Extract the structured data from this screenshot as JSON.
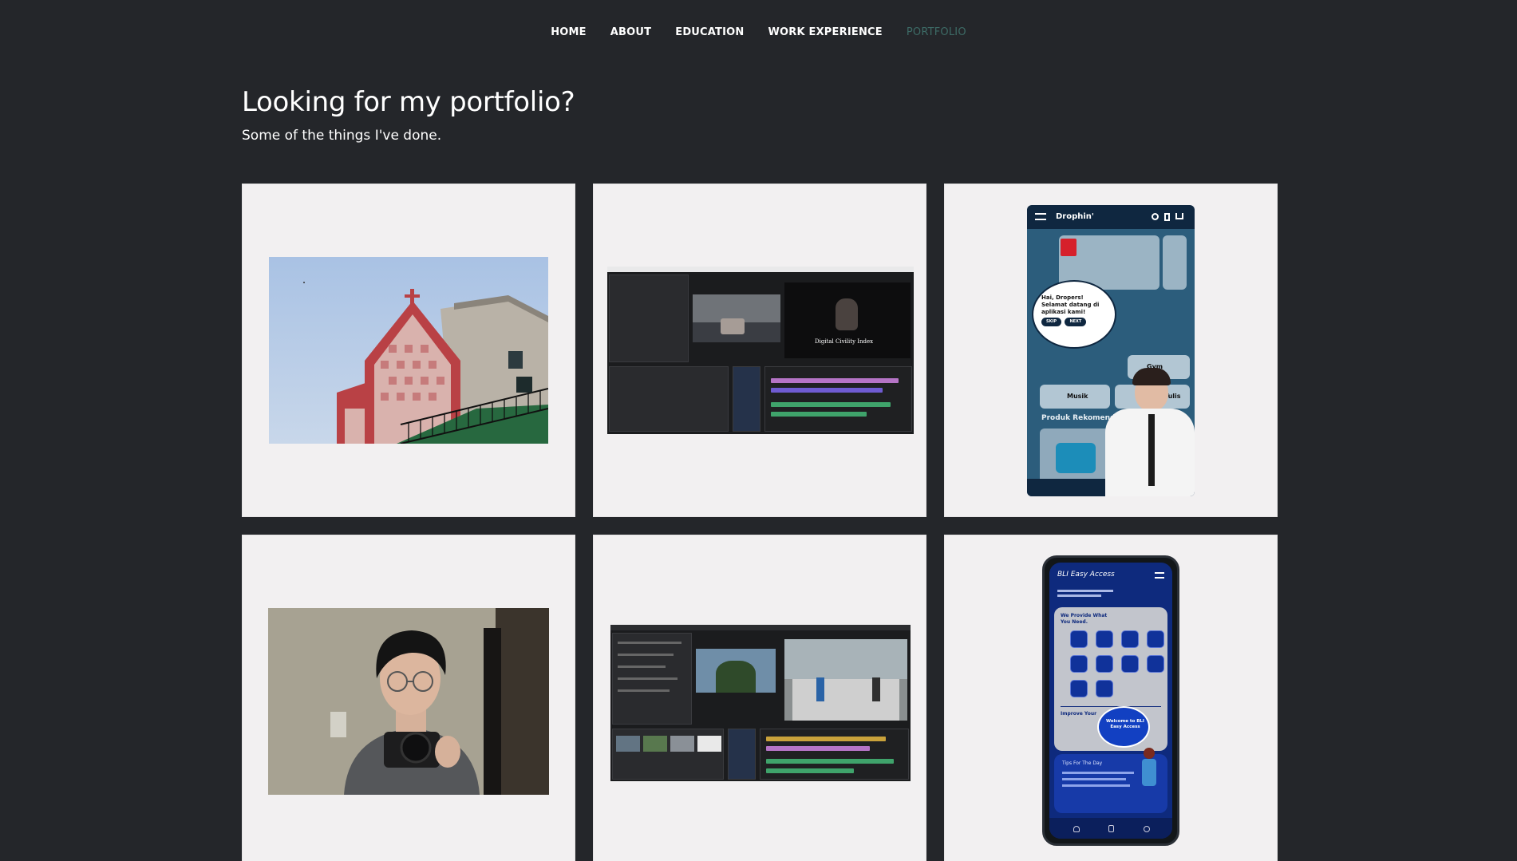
{
  "nav": {
    "items": [
      {
        "label": "HOME"
      },
      {
        "label": "ABOUT"
      },
      {
        "label": "EDUCATION"
      },
      {
        "label": "WORK EXPERIENCE"
      },
      {
        "label": "PORTFOLIO"
      }
    ],
    "active_index": 4,
    "active_color": "#3d6b66"
  },
  "header": {
    "title": "Looking for my portfolio?",
    "subtitle": "Some of the things I've done."
  },
  "colors": {
    "background": "#24262a",
    "card": "#f2f0f1",
    "text": "#ffffff"
  },
  "portfolio": {
    "items": [
      {
        "kind": "photo-building"
      },
      {
        "kind": "video-editor",
        "overlay_text": "Digital Civility Index"
      },
      {
        "kind": "mobile-app",
        "app_name": "Drophin'",
        "bubble_lines": [
          "Hai, Dropers!",
          "Selamat datang di",
          "aplikasi kami!"
        ],
        "skip_label": "SKIP",
        "next_label": "NEXT",
        "section_label": "Produk Rekomendasi",
        "tile_gym": "Gym",
        "tile_music": "Musik",
        "tile_write": "Tulis"
      },
      {
        "kind": "photo-portrait"
      },
      {
        "kind": "video-editor"
      },
      {
        "kind": "mobile-app",
        "app_name": "BLI Easy Access",
        "provide_label": "We Provide What You Need.",
        "improve_label": "Improve Your",
        "welcome_label": "Welcome to BLI Easy Access",
        "tips_label": "Tips For The Day"
      }
    ]
  }
}
